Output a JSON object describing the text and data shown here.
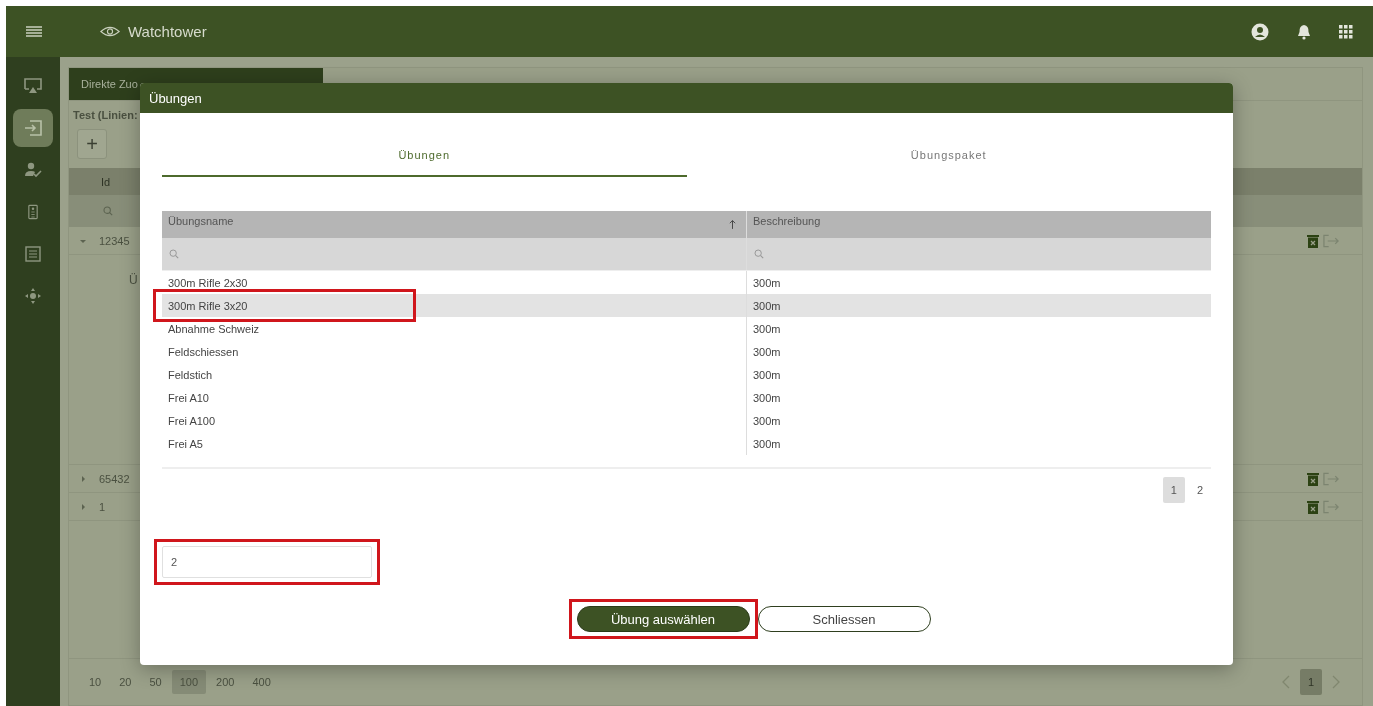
{
  "app": {
    "title": "Watchtower"
  },
  "sidebar": {
    "items": [
      {
        "kind": "screen",
        "selected": false
      },
      {
        "kind": "login",
        "selected": true
      },
      {
        "kind": "user-check",
        "selected": false
      },
      {
        "kind": "remote",
        "selected": false
      },
      {
        "kind": "list",
        "selected": false
      },
      {
        "kind": "move",
        "selected": false
      }
    ]
  },
  "background": {
    "tab": "Direkte Zuo",
    "caption": "Test (Linien:",
    "add_button": "+",
    "column": "Id",
    "rows": [
      {
        "id": "12345",
        "expanded": true,
        "detail": "Ü"
      },
      {
        "id": "65432",
        "expanded": false
      },
      {
        "id": "1",
        "expanded": false
      }
    ],
    "page_sizes": [
      {
        "label": "10",
        "selected": false
      },
      {
        "label": "20",
        "selected": false
      },
      {
        "label": "50",
        "selected": false
      },
      {
        "label": "100",
        "selected": true
      },
      {
        "label": "200",
        "selected": false
      },
      {
        "label": "400",
        "selected": false
      }
    ],
    "pages": [
      {
        "label": "1",
        "selected": true
      }
    ]
  },
  "dialog": {
    "title": "Übungen",
    "tabs": [
      {
        "label": "Übungen",
        "selected": true
      },
      {
        "label": "Übungspaket",
        "selected": false
      }
    ],
    "columns": [
      {
        "label": "Übungsname",
        "sorted_ascending": true
      },
      {
        "label": "Beschreibung"
      }
    ],
    "rows": [
      {
        "name": "300m Rifle 2x30",
        "description": "300m",
        "selected": false
      },
      {
        "name": "300m Rifle 3x20",
        "description": "300m",
        "selected": true,
        "highlighted": true
      },
      {
        "name": "Abnahme Schweiz",
        "description": "300m",
        "selected": false
      },
      {
        "name": "Feldschiessen",
        "description": "300m",
        "selected": false
      },
      {
        "name": "Feldstich",
        "description": "300m",
        "selected": false
      },
      {
        "name": "Frei A10",
        "description": "300m",
        "selected": false
      },
      {
        "name": "Frei A100",
        "description": "300m",
        "selected": false
      },
      {
        "name": "Frei A5",
        "description": "300m",
        "selected": false
      }
    ],
    "pages": [
      {
        "label": "1",
        "selected": true
      },
      {
        "label": "2",
        "selected": false
      }
    ],
    "input": {
      "value": "2",
      "highlighted": true
    },
    "buttons": [
      {
        "label": "Übung auswählen",
        "kind": "primary",
        "highlighted": true
      },
      {
        "label": "Schliessen",
        "kind": "secondary"
      }
    ]
  }
}
